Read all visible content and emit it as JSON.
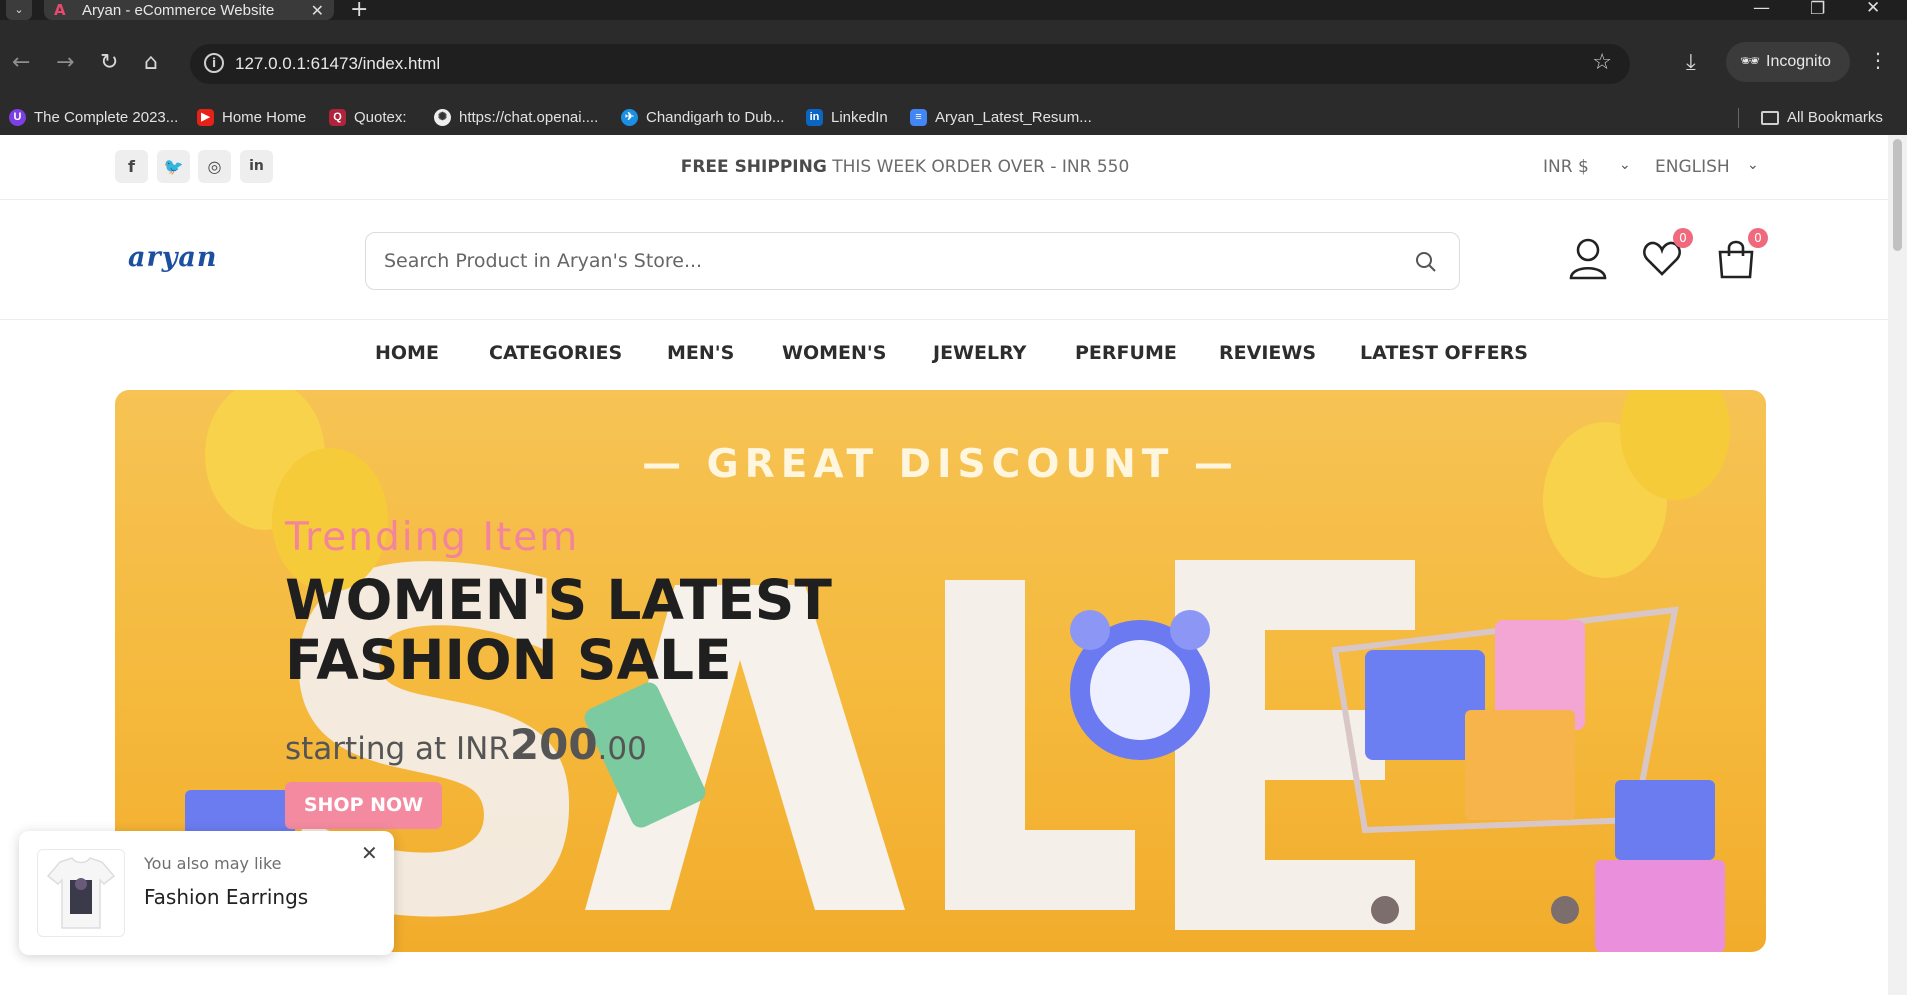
{
  "browser": {
    "tab_title": "Aryan - eCommerce Website",
    "url": "127.0.0.1:61473/index.html",
    "incognito_label": "Incognito",
    "bookmarks": [
      {
        "label": "The Complete 2023...",
        "icon": "purple-circle-icon",
        "color": "#7b3fe4"
      },
      {
        "label": "Home Home",
        "icon": "youtube-icon",
        "color": "#e62117"
      },
      {
        "label": "Quotex:",
        "icon": "quotex-icon",
        "color": "#b0233a"
      },
      {
        "label": "https://chat.openai....",
        "icon": "openai-icon",
        "color": "#444444"
      },
      {
        "label": "Chandigarh to Dub...",
        "icon": "plane-icon",
        "color": "#1a8fe3"
      },
      {
        "label": "LinkedIn",
        "icon": "linkedin-icon",
        "color": "#0a66c2"
      },
      {
        "label": "Aryan_Latest_Resum...",
        "icon": "docs-icon",
        "color": "#4285f4"
      }
    ],
    "all_bookmarks_label": "All Bookmarks"
  },
  "topbar": {
    "shipping_bold": "FREE SHIPPING",
    "shipping_rest": "THIS WEEK ORDER OVER - INR 550",
    "currency": "INR $",
    "language": "ENGLISH"
  },
  "header": {
    "logo": "aryan",
    "search_placeholder": "Search Product in Aryan's Store...",
    "wishlist_count": "0",
    "cart_count": "0"
  },
  "nav": [
    "HOME",
    "CATEGORIES",
    "MEN'S",
    "WOMEN'S",
    "JEWELRY",
    "PERFUME",
    "REVIEWS",
    "LATEST OFFERS"
  ],
  "banner": {
    "discount_text": "— GREAT DISCOUNT —",
    "subtitle": "Trending Item",
    "title_line1": "WOMEN'S LATEST",
    "title_line2": "FASHION SALE",
    "price_prefix": "starting at INR",
    "price_main": "200",
    "price_decimal": ".00",
    "button": "SHOP NOW"
  },
  "toast": {
    "subtitle": "You also may like",
    "title": "Fashion Earrings"
  },
  "colors": {
    "accent_pink": "#f48aa0",
    "badge": "#f06a7e",
    "banner_bg": "#f5b93c"
  }
}
